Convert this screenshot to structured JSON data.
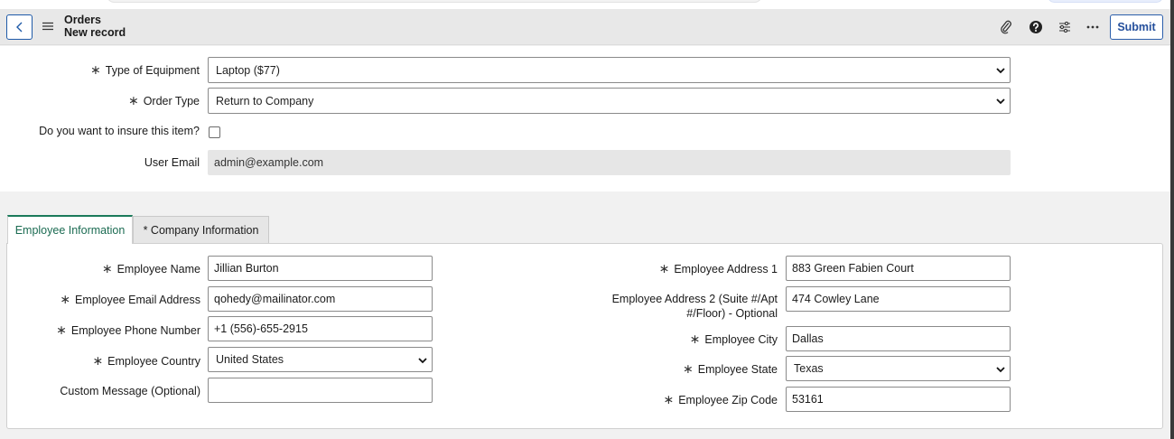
{
  "header": {
    "title": "Orders",
    "subtitle": "New record",
    "submit_label": "Submit",
    "icons": [
      "back-icon",
      "hamburger-menu-icon",
      "paperclip-icon",
      "help-icon",
      "sliders-icon",
      "more-icon"
    ]
  },
  "form": {
    "type_of_equipment": {
      "label": "Type of Equipment",
      "value": "Laptop ($77)",
      "required": true
    },
    "order_type": {
      "label": "Order Type",
      "value": "Return to Company",
      "required": true
    },
    "insure_item": {
      "label": "Do you want to insure this item?",
      "checked": false
    },
    "user_email": {
      "label": "User Email",
      "value": "admin@example.com"
    }
  },
  "tabs": [
    {
      "label": "Employee Information",
      "active": true
    },
    {
      "label": "* Company Information",
      "active": false
    }
  ],
  "employee": {
    "name": {
      "label": "Employee Name",
      "value": "Jillian Burton"
    },
    "email": {
      "label": "Employee Email Address",
      "value": "qohedy@mailinator.com"
    },
    "phone": {
      "label": "Employee Phone Number",
      "value": "+1 (556)-655-2915"
    },
    "country": {
      "label": "Employee Country",
      "value": "United States"
    },
    "custom_message": {
      "label": "Custom Message (Optional)",
      "value": ""
    },
    "address1": {
      "label": "Employee Address 1",
      "value": "883 Green Fabien Court"
    },
    "address2": {
      "label_line1": "Employee Address 2 (Suite #/Apt",
      "label_line2": "#/Floor) - Optional",
      "value": "474 Cowley Lane"
    },
    "city": {
      "label": "Employee City",
      "value": "Dallas"
    },
    "state": {
      "label": "Employee State",
      "value": "Texas"
    },
    "zip": {
      "label": "Employee Zip Code",
      "value": "53161"
    }
  },
  "colors": {
    "accent_blue": "#1f5aa8",
    "tab_green": "#1b7a5a",
    "readonly_bg": "#e6e6e6"
  }
}
